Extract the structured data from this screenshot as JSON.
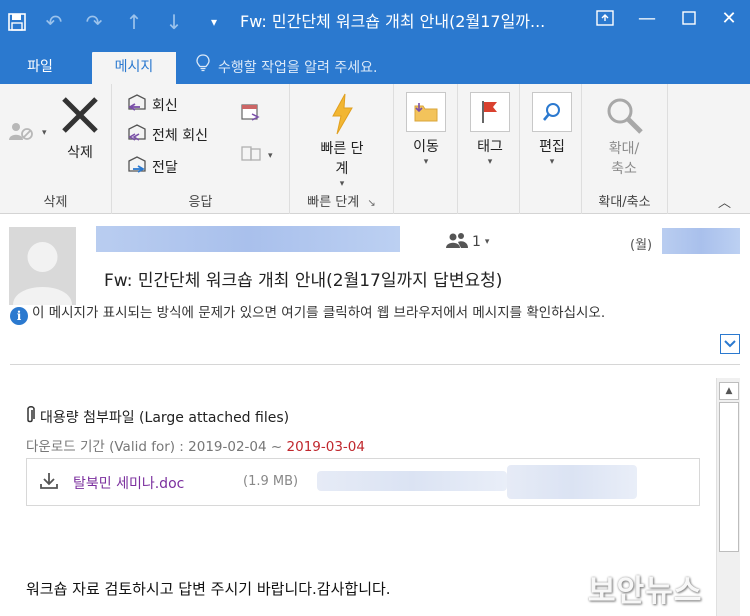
{
  "window": {
    "title": "Fw: 민간단체 워크숍 개최 안내(2월17일까..."
  },
  "tabs": [
    {
      "label": "파일"
    },
    {
      "label": "메시지"
    }
  ],
  "tell_me": "수행할 작업을 알려 주세요.",
  "ribbon": {
    "delete_group": {
      "button": "삭제",
      "label": "삭제"
    },
    "respond_group": {
      "reply": "회신",
      "reply_all": "전체 회신",
      "forward": "전달",
      "label": "응답"
    },
    "quick_steps_group": {
      "line1": "빠른 단",
      "line2": "계",
      "label": "빠른 단계"
    },
    "move_group": {
      "button": "이동"
    },
    "tags_group": {
      "button": "태그"
    },
    "editing_group": {
      "button": "편집"
    },
    "zoom_group": {
      "line1": "확대/",
      "line2": "축소",
      "label": "확대/축소"
    }
  },
  "message": {
    "people_count": "1",
    "day": "(월)",
    "subject": "Fw: 민간단체 워크숍 개최 안내(2월17일까지 답변요청)",
    "info_bar": "이 메시지가 표시되는 방식에 문제가 있으면 여기를 클릭하여 웹 브라우저에서 메시지를 확인하십시오."
  },
  "body": {
    "attach_title": "대용량 첨부파일 (Large attached files)",
    "valid_prefix": "다운로드 기간 (Valid for) : 2019-02-04 ~ ",
    "valid_end": "2019-03-04",
    "file_name": "탈북민 세미나.doc",
    "file_size": "(1.9 MB)",
    "closing": "워크숍 자료 검토하시고 답변 주시기 바랍니다.감사합니다."
  },
  "watermark": "보안뉴스",
  "colors": {
    "accent": "#2b79cf",
    "date_red": "#c0272d",
    "file_link": "#7b2f9e"
  }
}
